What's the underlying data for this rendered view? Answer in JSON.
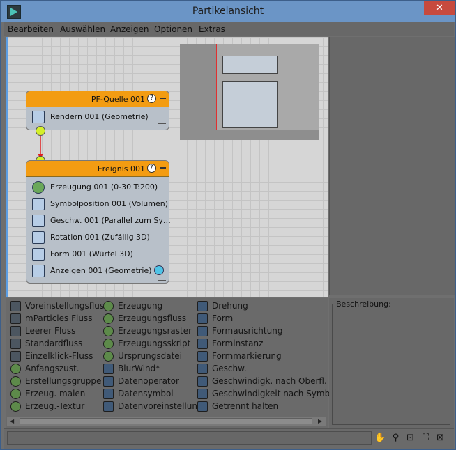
{
  "window": {
    "title": "Partikelansicht",
    "close_glyph": "✕"
  },
  "menu": [
    "Bearbeiten",
    "Auswählen",
    "Anzeigen",
    "Optionen",
    "Extras"
  ],
  "nodes": {
    "source": {
      "title": "PF-Quelle 001",
      "ops": [
        "Rendern 001 (Geometrie)"
      ]
    },
    "event": {
      "title": "Ereignis 001",
      "ops": [
        "Erzeugung 001 (0-30 T:200)",
        "Symbolposition 001 (Volumen)",
        "Geschw. 001 (Parallel zum Sy…",
        "Rotation 001 (Zufällig 3D)",
        "Form 001 (Würfel 3D)",
        "Anzeigen 001 (Geometrie)"
      ]
    }
  },
  "depot": {
    "col1": [
      "Voreinstellungsfluss",
      "mParticles Fluss",
      "Leerer Fluss",
      "Standardfluss",
      "Einzelklick-Fluss",
      "Anfangszust.",
      "Erstellungsgruppe",
      "Erzeug. malen",
      "Erzeug.-Textur"
    ],
    "col2": [
      "Erzeugung",
      "Erzeugungsfluss",
      "Erzeugungsraster",
      "Erzeugungsskript",
      "Ursprungsdatei",
      "BlurWind*",
      "Datenoperator",
      "Datensymbol",
      "Datenvoreinstellung"
    ],
    "col3": [
      "Drehung",
      "Form",
      "Formausrichtung",
      "Forminstanz",
      "Formmarkierung",
      "Geschw.",
      "Geschwindigk. nach Oberfl.",
      "Geschwindigkeit nach Symbol",
      "Getrennt halten"
    ]
  },
  "description": {
    "label": "Beschreibung:"
  },
  "colors": {
    "node_header": "#f39c12",
    "socket": "#d4ef2a",
    "wire": "#e02020",
    "canvas": "#d6d6d6"
  }
}
